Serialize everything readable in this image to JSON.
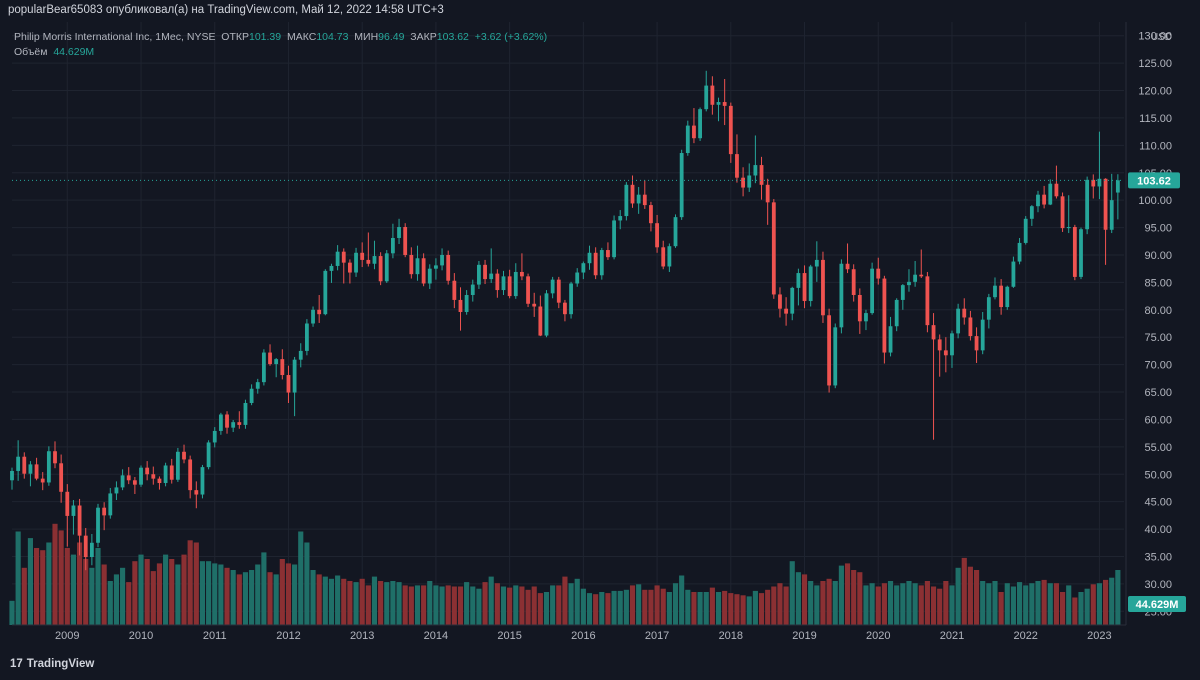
{
  "header": {
    "publisher": "popularBear65083 опубликовал(а) на TradingView.com, Май 12, 2022 14:58 UTC+3"
  },
  "legend": {
    "symbol": "Philip Morris International Inc, 1Мес, NYSE",
    "open_label": "ОТКР",
    "open": "101.39",
    "high_label": "МАКС",
    "high": "104.73",
    "low_label": "МИН",
    "low": "96.49",
    "close_label": "ЗАКР",
    "close": "103.62",
    "change": "+3.62 (+3.62%)",
    "volume_label": "Объём",
    "volume": "44.629M"
  },
  "footer": {
    "logo_mark": "17",
    "logo_text": "TradingView"
  },
  "colors": {
    "up": "#26a69a",
    "down": "#ef5350",
    "vol_up": "#1f6f68",
    "vol_down": "#8b3033",
    "bg": "#131722",
    "grid": "#1f2430"
  },
  "chart_data": {
    "type": "candlestick",
    "currency": "USD",
    "last_price_label": "103.62",
    "last_volume_label": "44.629M",
    "ylim": [
      22.5,
      132.5
    ],
    "y_ticks": [
      "25.00",
      "30.00",
      "35.00",
      "40.00",
      "45.00",
      "50.00",
      "55.00",
      "60.00",
      "65.00",
      "70.00",
      "75.00",
      "80.00",
      "85.00",
      "90.00",
      "95.00",
      "100.00",
      "105.00",
      "110.00",
      "115.00",
      "120.00",
      "125.00",
      "130.00"
    ],
    "x_ticks": [
      "2009",
      "2010",
      "2011",
      "2012",
      "2013",
      "2014",
      "2015",
      "2016",
      "2017",
      "2018",
      "2019",
      "2020",
      "2021",
      "2022",
      "2023"
    ],
    "x_range": [
      "2008-04",
      "2023-05"
    ],
    "candles_ohlc": [
      [
        48.9,
        51.2,
        47.2,
        50.6
      ],
      [
        50.6,
        56.2,
        48.8,
        53.2
      ],
      [
        53.2,
        54.0,
        49.2,
        50.1
      ],
      [
        50.1,
        52.4,
        47.8,
        51.8
      ],
      [
        51.8,
        53.0,
        48.9,
        49.2
      ],
      [
        49.2,
        50.4,
        47.1,
        48.5
      ],
      [
        48.5,
        55.1,
        47.9,
        54.2
      ],
      [
        54.2,
        56.0,
        51.1,
        52.0
      ],
      [
        52.0,
        53.6,
        44.8,
        46.8
      ],
      [
        46.8,
        48.2,
        36.8,
        42.4
      ],
      [
        42.4,
        45.3,
        39.0,
        44.3
      ],
      [
        44.3,
        45.5,
        35.2,
        38.8
      ],
      [
        38.8,
        40.2,
        32.5,
        34.9
      ],
      [
        34.9,
        39.1,
        33.4,
        37.5
      ],
      [
        37.5,
        44.6,
        36.7,
        43.9
      ],
      [
        43.9,
        44.9,
        39.8,
        42.5
      ],
      [
        42.5,
        47.5,
        41.9,
        46.5
      ],
      [
        46.5,
        48.7,
        45.3,
        47.6
      ],
      [
        47.6,
        50.9,
        47.1,
        49.8
      ],
      [
        49.8,
        51.3,
        48.2,
        48.9
      ],
      [
        48.9,
        49.5,
        46.4,
        48.1
      ],
      [
        48.1,
        51.6,
        47.7,
        51.2
      ],
      [
        51.2,
        52.4,
        48.9,
        50.0
      ],
      [
        50.0,
        51.4,
        48.1,
        49.2
      ],
      [
        49.2,
        49.6,
        47.2,
        48.4
      ],
      [
        48.4,
        52.1,
        47.8,
        51.6
      ],
      [
        51.6,
        52.8,
        48.3,
        49.0
      ],
      [
        49.0,
        54.8,
        48.6,
        54.1
      ],
      [
        54.1,
        55.4,
        52.0,
        52.7
      ],
      [
        52.7,
        53.4,
        45.6,
        47.1
      ],
      [
        47.1,
        48.7,
        43.8,
        46.3
      ],
      [
        46.3,
        51.7,
        45.6,
        51.3
      ],
      [
        51.3,
        56.2,
        50.9,
        55.8
      ],
      [
        55.8,
        58.6,
        54.9,
        57.9
      ],
      [
        57.9,
        61.2,
        57.2,
        60.9
      ],
      [
        60.9,
        61.5,
        57.4,
        58.5
      ],
      [
        58.5,
        59.9,
        57.7,
        59.5
      ],
      [
        59.5,
        61.5,
        58.3,
        59.0
      ],
      [
        59.0,
        63.6,
        58.3,
        63.0
      ],
      [
        63.0,
        66.4,
        62.6,
        65.6
      ],
      [
        65.6,
        67.4,
        64.7,
        66.8
      ],
      [
        66.8,
        72.8,
        66.2,
        72.2
      ],
      [
        72.2,
        73.7,
        69.8,
        70.1
      ],
      [
        70.1,
        71.2,
        67.7,
        71.0
      ],
      [
        71.0,
        72.8,
        67.3,
        68.1
      ],
      [
        68.1,
        69.8,
        63.0,
        64.9
      ],
      [
        64.9,
        71.4,
        60.6,
        70.9
      ],
      [
        70.9,
        73.9,
        69.5,
        72.5
      ],
      [
        72.5,
        78.3,
        71.7,
        77.5
      ],
      [
        77.5,
        80.6,
        76.9,
        80.0
      ],
      [
        80.0,
        82.7,
        77.6,
        79.2
      ],
      [
        79.2,
        87.4,
        79.0,
        87.1
      ],
      [
        87.1,
        88.4,
        84.9,
        88.0
      ],
      [
        88.0,
        91.8,
        87.2,
        90.6
      ],
      [
        90.6,
        91.2,
        84.8,
        88.6
      ],
      [
        88.6,
        89.2,
        84.8,
        86.8
      ],
      [
        86.8,
        91.3,
        86.0,
        90.4
      ],
      [
        90.4,
        92.3,
        87.8,
        89.1
      ],
      [
        89.1,
        94.1,
        87.9,
        88.4
      ],
      [
        88.4,
        92.6,
        87.4,
        89.8
      ],
      [
        89.8,
        90.5,
        84.5,
        85.2
      ],
      [
        85.2,
        90.9,
        84.9,
        90.3
      ],
      [
        90.3,
        95.7,
        89.4,
        93.1
      ],
      [
        93.1,
        96.6,
        92.0,
        95.1
      ],
      [
        95.1,
        95.8,
        89.6,
        90.0
      ],
      [
        90.0,
        91.4,
        85.7,
        86.5
      ],
      [
        86.5,
        91.7,
        85.3,
        89.4
      ],
      [
        89.4,
        90.3,
        84.3,
        84.8
      ],
      [
        84.8,
        88.3,
        83.8,
        87.5
      ],
      [
        87.5,
        89.4,
        85.5,
        88.1
      ],
      [
        88.1,
        91.2,
        87.2,
        90.0
      ],
      [
        90.0,
        90.8,
        84.6,
        85.3
      ],
      [
        85.3,
        86.7,
        80.3,
        81.8
      ],
      [
        81.8,
        84.1,
        76.2,
        79.6
      ],
      [
        79.6,
        83.6,
        79.1,
        82.7
      ],
      [
        82.7,
        85.5,
        81.5,
        84.6
      ],
      [
        84.6,
        88.9,
        83.8,
        88.2
      ],
      [
        88.2,
        89.1,
        84.7,
        85.6
      ],
      [
        85.6,
        91.2,
        84.9,
        86.6
      ],
      [
        86.6,
        87.4,
        82.2,
        83.6
      ],
      [
        83.6,
        87.1,
        82.7,
        86.1
      ],
      [
        86.1,
        87.3,
        82.1,
        82.5
      ],
      [
        82.5,
        88.5,
        82.0,
        86.9
      ],
      [
        86.9,
        90.3,
        85.4,
        86.1
      ],
      [
        86.1,
        86.6,
        80.5,
        81.1
      ],
      [
        81.1,
        83.1,
        78.7,
        80.6
      ],
      [
        80.6,
        82.6,
        75.2,
        75.3
      ],
      [
        75.3,
        83.6,
        75.0,
        83.0
      ],
      [
        83.0,
        86.0,
        82.1,
        85.5
      ],
      [
        85.5,
        86.0,
        80.3,
        81.3
      ],
      [
        81.3,
        81.8,
        77.9,
        79.2
      ],
      [
        79.2,
        85.1,
        78.4,
        84.8
      ],
      [
        84.8,
        87.6,
        84.2,
        86.8
      ],
      [
        86.8,
        88.8,
        85.6,
        88.5
      ],
      [
        88.5,
        91.7,
        87.3,
        90.4
      ],
      [
        90.4,
        91.4,
        85.6,
        86.3
      ],
      [
        86.3,
        91.3,
        85.5,
        90.9
      ],
      [
        90.9,
        92.3,
        89.1,
        89.6
      ],
      [
        89.6,
        97.2,
        89.2,
        96.3
      ],
      [
        96.3,
        98.2,
        94.7,
        97.1
      ],
      [
        97.1,
        103.3,
        96.3,
        102.8
      ],
      [
        102.8,
        104.5,
        98.6,
        99.4
      ],
      [
        99.4,
        102.4,
        97.5,
        101.0
      ],
      [
        101.0,
        103.6,
        98.4,
        99.1
      ],
      [
        99.1,
        99.7,
        94.3,
        95.8
      ],
      [
        95.8,
        97.3,
        90.4,
        91.4
      ],
      [
        91.4,
        92.6,
        87.4,
        87.9
      ],
      [
        87.9,
        92.1,
        86.9,
        91.6
      ],
      [
        91.6,
        97.4,
        91.3,
        96.9
      ],
      [
        96.9,
        109.2,
        96.4,
        108.6
      ],
      [
        108.6,
        114.5,
        108.1,
        113.6
      ],
      [
        113.6,
        116.8,
        110.4,
        111.3
      ],
      [
        111.3,
        116.9,
        110.8,
        116.6
      ],
      [
        116.6,
        123.6,
        116.2,
        120.9
      ],
      [
        120.9,
        122.6,
        115.6,
        117.4
      ],
      [
        117.4,
        118.7,
        114.4,
        117.9
      ],
      [
        117.9,
        122.1,
        113.7,
        117.2
      ],
      [
        117.2,
        117.8,
        106.8,
        108.4
      ],
      [
        108.4,
        112.0,
        103.2,
        104.1
      ],
      [
        104.1,
        106.0,
        100.7,
        102.3
      ],
      [
        102.3,
        106.7,
        101.5,
        104.5
      ],
      [
        104.5,
        111.8,
        103.1,
        106.4
      ],
      [
        106.4,
        107.9,
        100.1,
        102.8
      ],
      [
        102.8,
        103.9,
        95.5,
        99.6
      ],
      [
        99.6,
        100.2,
        82.0,
        82.8
      ],
      [
        82.8,
        84.1,
        78.6,
        80.2
      ],
      [
        80.2,
        82.3,
        77.1,
        79.3
      ],
      [
        79.3,
        84.2,
        78.1,
        84.0
      ],
      [
        84.0,
        87.5,
        80.8,
        86.7
      ],
      [
        86.7,
        88.1,
        80.3,
        81.6
      ],
      [
        81.6,
        88.2,
        80.6,
        87.9
      ],
      [
        87.9,
        92.5,
        85.1,
        89.1
      ],
      [
        89.1,
        90.6,
        77.6,
        79.0
      ],
      [
        79.0,
        80.2,
        64.9,
        66.2
      ],
      [
        66.2,
        77.5,
        65.7,
        76.8
      ],
      [
        76.8,
        89.2,
        75.7,
        88.4
      ],
      [
        88.4,
        92.1,
        86.7,
        87.4
      ],
      [
        87.4,
        88.3,
        81.5,
        82.7
      ],
      [
        82.7,
        83.9,
        75.6,
        77.9
      ],
      [
        77.9,
        80.0,
        76.3,
        79.4
      ],
      [
        79.4,
        88.6,
        79.1,
        87.5
      ],
      [
        87.5,
        89.5,
        84.6,
        85.7
      ],
      [
        85.7,
        86.2,
        70.2,
        72.2
      ],
      [
        72.2,
        78.7,
        71.5,
        77.0
      ],
      [
        77.0,
        82.1,
        76.1,
        81.8
      ],
      [
        81.8,
        84.7,
        80.0,
        84.5
      ],
      [
        84.5,
        87.4,
        83.3,
        85.1
      ],
      [
        85.1,
        88.9,
        84.2,
        86.4
      ],
      [
        86.4,
        91.0,
        85.8,
        86.1
      ],
      [
        86.1,
        86.9,
        75.9,
        77.2
      ],
      [
        77.2,
        79.4,
        56.3,
        74.6
      ],
      [
        74.6,
        75.5,
        67.8,
        72.6
      ],
      [
        72.6,
        75.0,
        68.6,
        71.7
      ],
      [
        71.7,
        76.2,
        69.4,
        75.7
      ],
      [
        75.7,
        81.1,
        74.8,
        80.2
      ],
      [
        80.2,
        82.1,
        77.3,
        78.6
      ],
      [
        78.6,
        79.8,
        74.4,
        75.2
      ],
      [
        75.2,
        76.8,
        70.3,
        72.6
      ],
      [
        72.6,
        79.6,
        71.9,
        78.2
      ],
      [
        78.2,
        82.9,
        76.6,
        82.3
      ],
      [
        82.3,
        85.9,
        81.9,
        84.4
      ],
      [
        84.4,
        85.6,
        79.1,
        80.5
      ],
      [
        80.5,
        84.4,
        80.0,
        84.2
      ],
      [
        84.2,
        89.7,
        84.0,
        88.8
      ],
      [
        88.8,
        93.1,
        88.3,
        92.2
      ],
      [
        92.2,
        97.1,
        91.9,
        96.6
      ],
      [
        96.6,
        99.1,
        95.3,
        98.9
      ],
      [
        98.9,
        101.7,
        97.8,
        101.0
      ],
      [
        101.0,
        102.6,
        98.5,
        99.2
      ],
      [
        99.2,
        103.8,
        99.1,
        103.0
      ],
      [
        103.0,
        106.3,
        100.3,
        100.7
      ],
      [
        100.7,
        101.4,
        94.2,
        94.9
      ],
      [
        94.9,
        100.9,
        94.0,
        95.1
      ],
      [
        95.1,
        95.5,
        85.4,
        86.0
      ],
      [
        86.0,
        95.0,
        85.6,
        94.7
      ],
      [
        94.7,
        104.3,
        93.8,
        103.7
      ],
      [
        103.7,
        104.7,
        100.3,
        102.5
      ],
      [
        102.5,
        112.5,
        100.2,
        103.9
      ],
      [
        103.9,
        104.0,
        88.2,
        94.6
      ],
      [
        94.6,
        104.8,
        94.0,
        100.0
      ],
      [
        101.39,
        104.73,
        96.49,
        103.62
      ]
    ],
    "volume_relative": [
      0.22,
      0.85,
      0.52,
      0.79,
      0.7,
      0.68,
      0.75,
      0.92,
      0.86,
      0.7,
      0.64,
      0.75,
      0.6,
      0.52,
      0.7,
      0.55,
      0.4,
      0.46,
      0.52,
      0.39,
      0.58,
      0.64,
      0.6,
      0.49,
      0.56,
      0.64,
      0.6,
      0.55,
      0.64,
      0.77,
      0.75,
      0.58,
      0.58,
      0.56,
      0.55,
      0.52,
      0.5,
      0.46,
      0.48,
      0.5,
      0.55,
      0.66,
      0.48,
      0.46,
      0.6,
      0.56,
      0.55,
      0.85,
      0.75,
      0.5,
      0.46,
      0.44,
      0.42,
      0.45,
      0.42,
      0.4,
      0.39,
      0.42,
      0.36,
      0.44,
      0.4,
      0.39,
      0.4,
      0.39,
      0.36,
      0.35,
      0.36,
      0.36,
      0.4,
      0.36,
      0.35,
      0.36,
      0.35,
      0.35,
      0.39,
      0.35,
      0.33,
      0.39,
      0.44,
      0.38,
      0.35,
      0.34,
      0.36,
      0.35,
      0.32,
      0.35,
      0.29,
      0.3,
      0.36,
      0.36,
      0.44,
      0.38,
      0.42,
      0.33,
      0.29,
      0.28,
      0.3,
      0.29,
      0.31,
      0.31,
      0.32,
      0.36,
      0.37,
      0.32,
      0.32,
      0.36,
      0.33,
      0.3,
      0.38,
      0.45,
      0.32,
      0.3,
      0.3,
      0.3,
      0.34,
      0.3,
      0.31,
      0.29,
      0.28,
      0.27,
      0.26,
      0.31,
      0.29,
      0.32,
      0.35,
      0.38,
      0.35,
      0.58,
      0.48,
      0.46,
      0.4,
      0.36,
      0.4,
      0.42,
      0.4,
      0.54,
      0.56,
      0.5,
      0.48,
      0.36,
      0.38,
      0.35,
      0.38,
      0.4,
      0.36,
      0.38,
      0.4,
      0.38,
      0.36,
      0.4,
      0.35,
      0.33,
      0.4,
      0.36,
      0.52,
      0.61,
      0.53,
      0.5,
      0.4,
      0.38,
      0.4,
      0.3,
      0.38,
      0.35,
      0.39,
      0.36,
      0.38,
      0.4,
      0.41,
      0.38,
      0.38,
      0.3,
      0.36,
      0.25,
      0.3,
      0.33,
      0.37,
      0.38,
      0.41,
      0.43,
      0.5,
      0.46,
      0.13
    ]
  }
}
